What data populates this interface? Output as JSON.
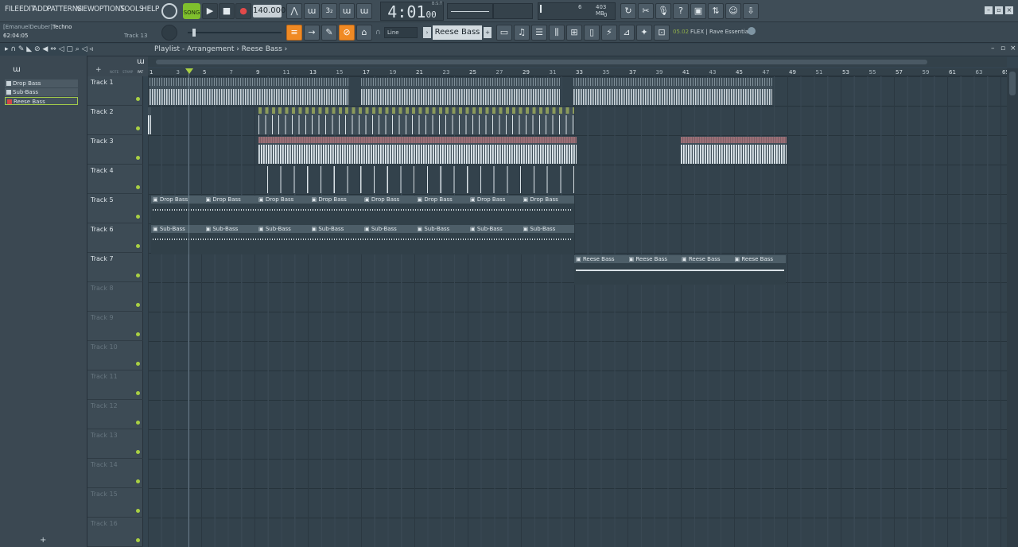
{
  "menu": [
    "FILE",
    "EDIT",
    "ADD",
    "PATTERNS",
    "VIEW",
    "OPTIONS",
    "TOOLS",
    "HELP"
  ],
  "project": {
    "user": "[EmanuelDeuber]",
    "genre": "Techno",
    "time": "62:04:05",
    "hint_track": "Track 13"
  },
  "transport": {
    "mode": "SONG",
    "tempo": "140.000",
    "time_main": "4:01",
    "time_sub": "00",
    "time_label": "B:S:T"
  },
  "meters": {
    "cpu": "6",
    "memory": "403 MB",
    "voices": "0"
  },
  "snap": {
    "mode": "Line"
  },
  "pattern_selector": {
    "value": "Reese Bass"
  },
  "news": {
    "date": "05.02",
    "text": "FLEX | Rave Essentials"
  },
  "playlist": {
    "breadcrumb": "Playlist - Arrangement › Reese Bass ›",
    "tabs": [
      "NOTE",
      "STAMP",
      "PAT"
    ]
  },
  "channels": [
    {
      "name": "Drop Bass",
      "selected": false
    },
    {
      "name": "Sub-Bass",
      "selected": false
    },
    {
      "name": "Reese Bass",
      "selected": true
    }
  ],
  "tracks": [
    "Track 1",
    "Track 2",
    "Track 3",
    "Track 4",
    "Track 5",
    "Track 6",
    "Track 7",
    "Track 8",
    "Track 9",
    "Track 10",
    "Track 11",
    "Track 12",
    "Track 13",
    "Track 14",
    "Track 15",
    "Track 16"
  ],
  "ruler": [
    "1",
    "3",
    "5",
    "7",
    "9",
    "11",
    "13",
    "15",
    "17",
    "19",
    "21",
    "23",
    "25",
    "27",
    "29",
    "31",
    "33",
    "35",
    "37",
    "39",
    "41",
    "43",
    "45",
    "47",
    "49",
    "51",
    "53",
    "55",
    "57",
    "59",
    "61",
    "63",
    "65"
  ],
  "pattern_clips": {
    "drop_bass": "Drop Bass",
    "sub_bass": "Sub-Bass",
    "reese_bass": "Reese Bass"
  }
}
